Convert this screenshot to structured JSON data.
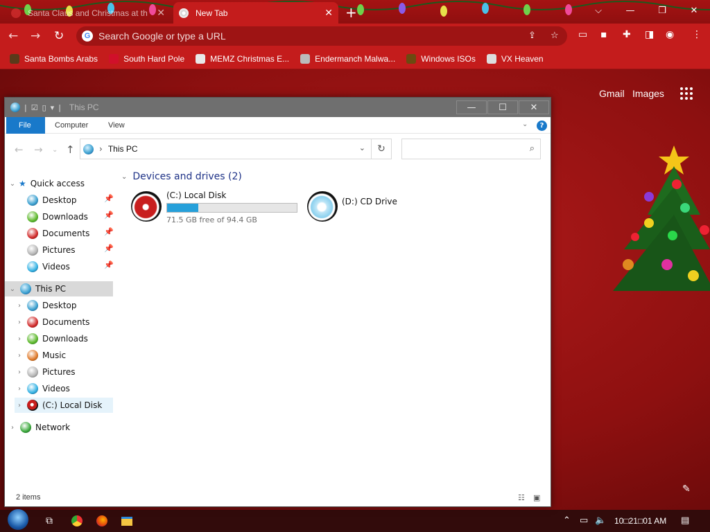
{
  "browser": {
    "tabs": [
      {
        "title": "Santa Claus and Christmas at th",
        "close": "✕"
      },
      {
        "title": "New Tab",
        "close": "✕"
      }
    ],
    "new_tab": "+",
    "window_controls": {
      "caret": "⌵",
      "minimize": "—",
      "restore": "❐",
      "close": "✕"
    },
    "omnibox": {
      "placeholder": "Search Google or type a URL",
      "g": "G"
    },
    "bookmarks": [
      {
        "label": "Santa Bombs Arabs",
        "color": "#5a3a1a"
      },
      {
        "label": "South Hard Pole",
        "color": "#d0102a"
      },
      {
        "label": "MEMZ Christmas E...",
        "color": "#e8e8e8"
      },
      {
        "label": "Endermanch Malwa...",
        "color": "#bbbbbb"
      },
      {
        "label": "Windows ISOs",
        "color": "#6b4a10"
      },
      {
        "label": "VX Heaven",
        "color": "#dddddd"
      }
    ]
  },
  "newtab_page": {
    "gmail": "Gmail",
    "images": "Images"
  },
  "explorer": {
    "title": "This PC",
    "ribbon_tabs": [
      "File",
      "Computer",
      "View"
    ],
    "help": "?",
    "address": {
      "crumb": "This PC",
      "refresh": "↻"
    },
    "quick_access": {
      "label": "Quick access",
      "items": [
        {
          "label": "Desktop",
          "color": "#3aa0d0"
        },
        {
          "label": "Downloads",
          "color": "#5cb82a"
        },
        {
          "label": "Documents",
          "color": "#d12a2a"
        },
        {
          "label": "Pictures",
          "color": "#b5b5b5"
        },
        {
          "label": "Videos",
          "color": "#34b2e4"
        }
      ]
    },
    "this_pc": {
      "label": "This PC",
      "items": [
        {
          "label": "Desktop",
          "color": "#3aa0d0"
        },
        {
          "label": "Documents",
          "color": "#d12a2a"
        },
        {
          "label": "Downloads",
          "color": "#5cb82a"
        },
        {
          "label": "Music",
          "color": "#e07a2a"
        },
        {
          "label": "Pictures",
          "color": "#b5b5b5"
        },
        {
          "label": "Videos",
          "color": "#34b2e4"
        },
        {
          "label": "(C:) Local Disk",
          "color": "#c81e1e"
        }
      ]
    },
    "network": "Network",
    "group": {
      "title": "Devices and drives (2)"
    },
    "drives": [
      {
        "name": "(C:) Local Disk",
        "free": "71.5 GB free of 94.4 GB",
        "used_fraction": 0.243
      },
      {
        "name": "(D:) CD Drive"
      }
    ],
    "status": "2 items"
  },
  "taskbar": {
    "clock": "10□21□01 AM",
    "apps": [
      "task-view",
      "chrome",
      "firefox",
      "file-explorer"
    ]
  },
  "colors": {
    "accent": "#1979ca",
    "drive_bar": "#26a0da",
    "chrome_red": "#c41c1c"
  }
}
